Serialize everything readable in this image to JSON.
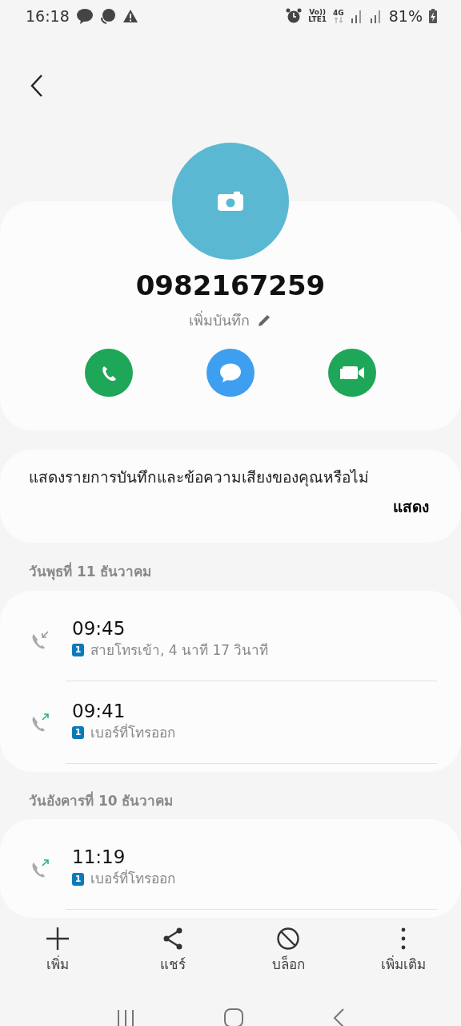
{
  "status_bar": {
    "time": "16:18",
    "volte": "Vo))",
    "lte": "LTE1",
    "network": "4G",
    "battery": "81%"
  },
  "contact": {
    "number": "0982167259",
    "note_link": "เพิ่มบันทึก"
  },
  "actions": [
    {
      "kind": "call"
    },
    {
      "kind": "message"
    },
    {
      "kind": "video"
    }
  ],
  "recordings_prompt": {
    "text": "แสดงรายการบันทึกและข้อความเสียงของคุณหรือไม่",
    "button": "แสดง"
  },
  "call_groups": [
    {
      "date": "วันพุธที่ 11 ธันวาคม",
      "calls": [
        {
          "kind": "incoming",
          "time": "09:45",
          "sim": "1",
          "detail": "สายโทรเข้า, 4 นาที 17 วินาที"
        },
        {
          "kind": "outgoing",
          "time": "09:41",
          "sim": "1",
          "detail": "เบอร์ที่โทรออก"
        }
      ]
    },
    {
      "date": "วันอังคารที่ 10 ธันวาคม",
      "calls": [
        {
          "kind": "outgoing",
          "time": "11:19",
          "sim": "1",
          "detail": "เบอร์ที่โทรออก"
        }
      ]
    }
  ],
  "bottom_bar": [
    {
      "kind": "add",
      "label": "เพิ่ม"
    },
    {
      "kind": "share",
      "label": "แชร์"
    },
    {
      "kind": "block",
      "label": "บล็อก"
    },
    {
      "kind": "more",
      "label": "เพิ่มเติม"
    }
  ]
}
